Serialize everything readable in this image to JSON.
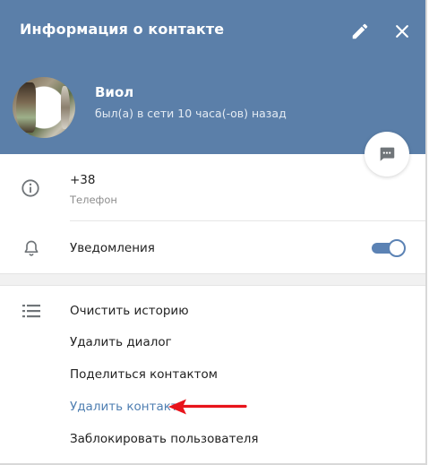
{
  "header": {
    "title": "Информация о контакте",
    "edit_icon": "pencil-icon",
    "close_icon": "close-icon"
  },
  "contact": {
    "name": "Виол",
    "status": "был(а) в сети 10 часа(-ов) назад",
    "message_icon": "chat-bubble-icon"
  },
  "phone": {
    "value": "+38",
    "label": "Телефон",
    "icon": "info-icon"
  },
  "notifications": {
    "label": "Уведомления",
    "enabled": true,
    "icon": "bell-icon"
  },
  "actions": {
    "icon": "list-icon",
    "items": [
      {
        "label": "Очистить историю"
      },
      {
        "label": "Удалить диалог"
      },
      {
        "label": "Поделиться контактом"
      },
      {
        "label": "Удалить контакт"
      },
      {
        "label": "Заблокировать пользователя"
      }
    ]
  },
  "annotation": {
    "arrow_icon": "red-arrow-icon",
    "color": "#e8141b"
  },
  "colors": {
    "header_bg": "#5b7fa9",
    "accent": "#4f7fb2",
    "toggle": "#5b82b4"
  }
}
